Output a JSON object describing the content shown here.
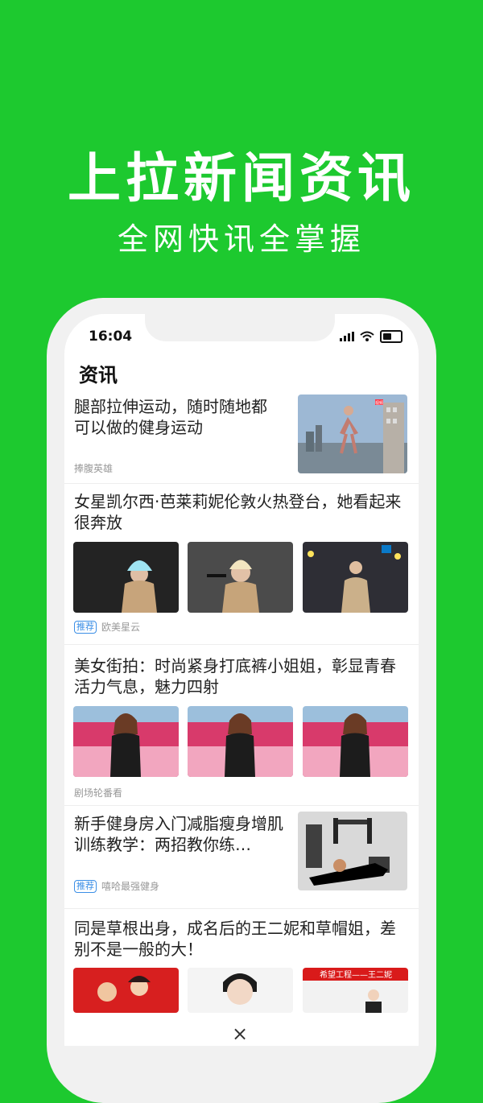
{
  "promo": {
    "headline": "上拉新闻资讯",
    "subheadline": "全网快讯全掌握"
  },
  "status_bar": {
    "time": "16:04"
  },
  "page": {
    "title": "资讯"
  },
  "articles": [
    {
      "title": "腿部拉伸运动，随时随地都可以做的健身运动",
      "source": "捧腹英雄",
      "tag": ""
    },
    {
      "title": "女星凯尔西·芭莱莉妮伦敦火热登台，她看起来很奔放",
      "source": "欧美星云",
      "tag": "推荐"
    },
    {
      "title": "美女街拍：时尚紧身打底裤小姐姐，彰显青春活力气息，魅力四射",
      "source": "剧场轮番看",
      "tag": ""
    },
    {
      "title": "新手健身房入门减脂瘦身增肌训练教学：两招教你练…",
      "source": "嘻哈最强健身",
      "tag": "推荐"
    },
    {
      "title": "同是草根出身，成名后的王二妮和草帽姐，差别不是一般的大！",
      "source": "",
      "tag": ""
    }
  ],
  "thumb_text": {
    "badge": "视频",
    "banner": "希望工程——王二妮"
  },
  "bottom_close": "×",
  "icons": {
    "wifi": "wifi-icon",
    "battery": "battery-icon",
    "signal": "signal-icon",
    "close": "close-icon"
  }
}
